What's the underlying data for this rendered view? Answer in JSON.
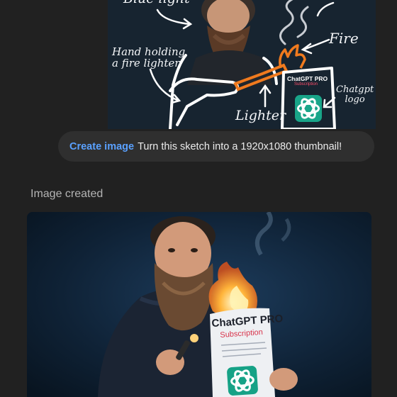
{
  "sketch": {
    "top_left_label": "Blue light",
    "hand_label_line1": "Hand holding",
    "hand_label_line2": "a fire lighter",
    "fire_label": "Fire",
    "lighter_label": "Lighter",
    "logo_label_line1": "Chatgpt",
    "logo_label_line2": "logo",
    "card_title": "ChatGPT PRO",
    "card_subtitle": "Subscription",
    "logo_icon": "openai-logo-icon"
  },
  "prompt": {
    "tag": "Create image",
    "message": "Turn this sketch into a 1920x1080 thumbnail!",
    "tag_color": "#5aa1ff",
    "bubble_color": "#2f2f2f"
  },
  "status": {
    "text": "Image created"
  },
  "result": {
    "document_title": "ChatGPT PRO",
    "document_subtitle": "Subscription",
    "logo_icon": "openai-logo-icon"
  },
  "colors": {
    "background": "#212121",
    "sketch_background": "#172430",
    "accent_orange": "#f07a1e",
    "logo_green": "#19a589"
  }
}
